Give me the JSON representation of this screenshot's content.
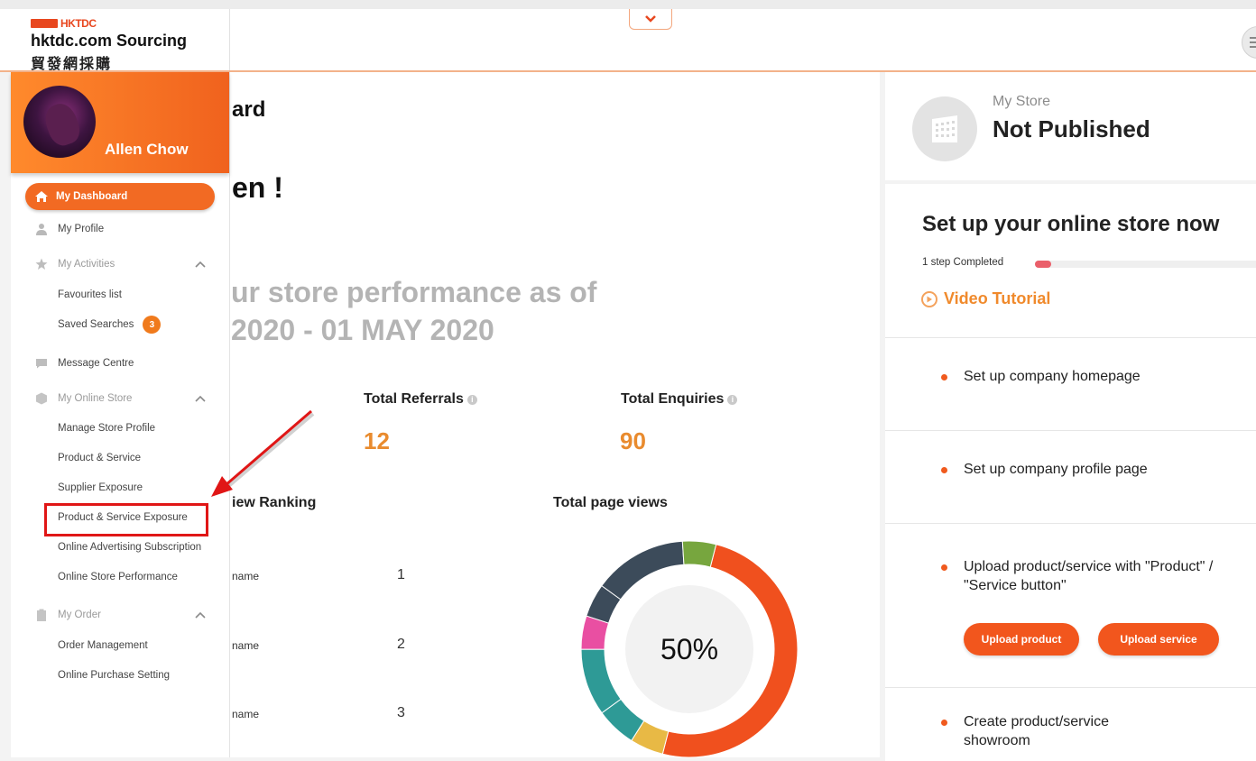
{
  "header": {
    "logo_hk": "HKTDC",
    "logo_title": "hktdc.com Sourcing",
    "logo_chinese": "貿發網採購"
  },
  "sidebar": {
    "user_name": "Allen Chow",
    "dashboard": "My Dashboard",
    "profile": "My Profile",
    "activities": "My Activities",
    "favourites": "Favourites list",
    "saved_searches": "Saved Searches",
    "saved_searches_count": "3",
    "message_centre": "Message Centre",
    "online_store": "My Online Store",
    "manage_store_profile": "Manage Store Profile",
    "product_service": "Product & Service",
    "supplier_exposure": "Supplier Exposure",
    "product_service_exposure": "Product & Service Exposure",
    "online_advertising": "Online Advertising Subscription",
    "online_store_performance": "Online Store Performance",
    "my_order": "My Order",
    "order_management": "Order Management",
    "online_purchase_setting": "Online Purchase Setting"
  },
  "main": {
    "dashboard_title": "ard",
    "greeting": "en !",
    "performance_line1": "ur store performance as of",
    "performance_line2": "2020 - 01 MAY 2020",
    "total_referrals_label": "Total Referrals",
    "total_referrals_value": "12",
    "total_enquiries_label": "Total Enquiries",
    "total_enquiries_value": "90",
    "ranking_title": "iew Ranking",
    "page_views_title": "Total page views",
    "ranking": [
      {
        "name": "name",
        "rank": "1"
      },
      {
        "name": "name",
        "rank": "2"
      },
      {
        "name": "name",
        "rank": "3"
      }
    ],
    "donut_center": "50%"
  },
  "chart_data": {
    "type": "pie",
    "title": "Total page views",
    "center_label": "50%",
    "slices": [
      {
        "value": 50,
        "color": "#f0501e"
      },
      {
        "value": 5,
        "color": "#e8b945"
      },
      {
        "value": 6,
        "color": "#2e9a96"
      },
      {
        "value": 10,
        "color": "#2e9a96"
      },
      {
        "value": 5,
        "color": "#e94fa2"
      },
      {
        "value": 5,
        "color": "#3c4b5a"
      },
      {
        "value": 14,
        "color": "#3c4b5a"
      },
      {
        "value": 5,
        "color": "#77a63e"
      }
    ]
  },
  "store": {
    "label": "My Store",
    "status": "Not Published",
    "setup_title": "Set up your online store now",
    "step_text": "1 step Completed",
    "progress_fraction": 0.07,
    "video_tutorial": "Video Tutorial",
    "tasks": [
      "Set up company homepage",
      "Set up company profile page",
      "Upload product/service with \"Product\" / \"Service button\"",
      "Create product/service showroom"
    ],
    "upload_product": "Upload product",
    "upload_service": "Upload service"
  },
  "colors": {
    "accent": "#f26a23",
    "value_orange": "#e98b2e",
    "highlight_red": "#e01616"
  }
}
